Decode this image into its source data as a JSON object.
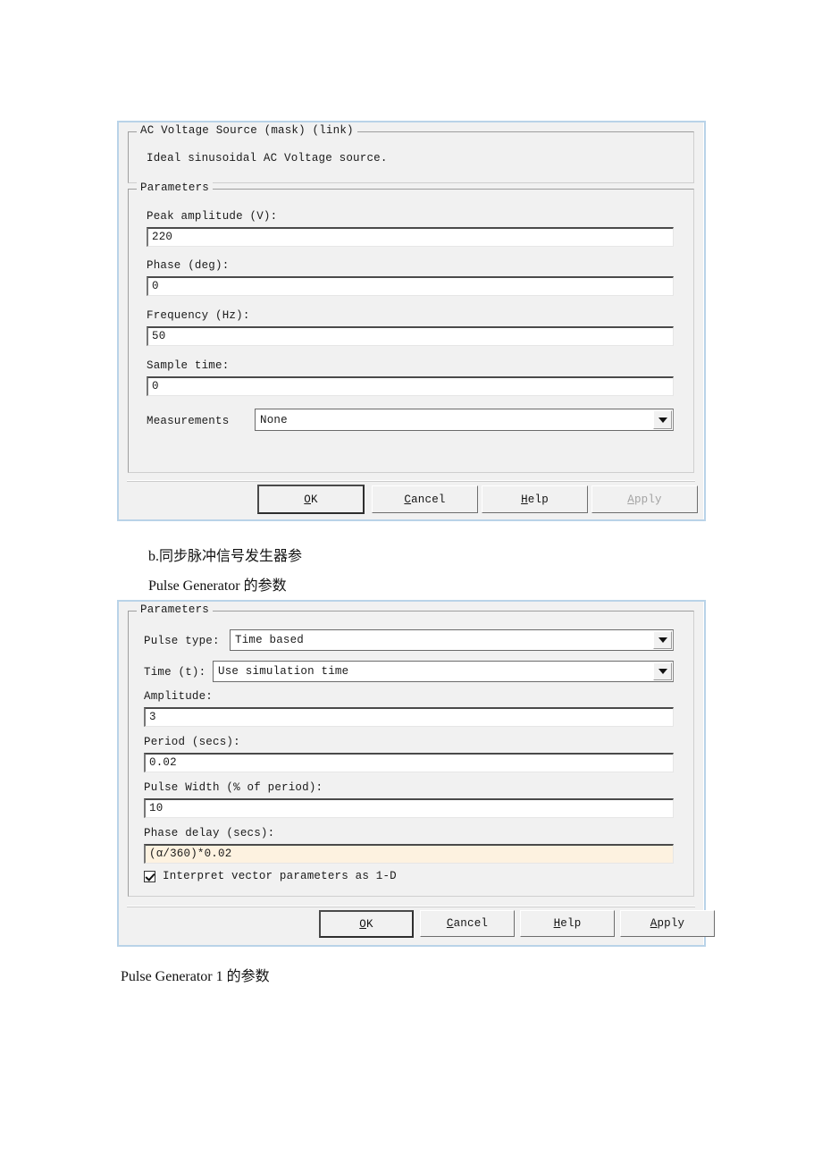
{
  "page": {
    "background": "#ffffff",
    "accent_border": "#b9d3e8",
    "highlight_field_color": "#fdf2e0"
  },
  "dialog_ac_voltage": {
    "description_group": {
      "title": "AC Voltage Source (mask) (link)",
      "text": "Ideal sinusoidal AC Voltage source."
    },
    "parameters_group": {
      "title": "Parameters"
    },
    "fields": [
      {
        "label": "Peak amplitude (V):",
        "value": "220",
        "type": "text"
      },
      {
        "label": "Phase (deg):",
        "value": "0",
        "type": "text"
      },
      {
        "label": "Frequency (Hz):",
        "value": "50",
        "type": "text"
      },
      {
        "label": "Sample time:",
        "value": "0",
        "type": "text"
      }
    ],
    "measurements": {
      "label": "Measurements",
      "value": "None",
      "type": "dropdown",
      "arrow_icon": "chevron-down-icon"
    },
    "buttons": [
      {
        "label": "OK",
        "mnemonic": "O",
        "rest": "K",
        "default": true,
        "disabled": false
      },
      {
        "label": "Cancel",
        "mnemonic": "C",
        "rest": "ancel",
        "default": false,
        "disabled": false
      },
      {
        "label": "Help",
        "mnemonic": "H",
        "rest": "elp",
        "default": false,
        "disabled": false
      },
      {
        "label": "Apply",
        "mnemonic": "A",
        "rest": "pply",
        "default": false,
        "disabled": true
      }
    ]
  },
  "caption_between": {
    "line1": "b.同步脉冲信号发生器参",
    "line2": "Pulse Generator  的参数"
  },
  "dialog_pulse_generator": {
    "parameters_group": {
      "title": "Parameters"
    },
    "inline_fields": [
      {
        "label": "Pulse type:",
        "value": "Time based",
        "type": "dropdown",
        "arrow_icon": "chevron-down-icon"
      },
      {
        "label": "Time (t):",
        "value": "Use simulation time",
        "type": "dropdown",
        "arrow_icon": "chevron-down-icon"
      }
    ],
    "stacked_fields": [
      {
        "label": "Amplitude:",
        "value": "3",
        "type": "text",
        "highlight": false
      },
      {
        "label": "Period (secs):",
        "value": "0.02",
        "type": "text",
        "highlight": false
      },
      {
        "label": "Pulse Width (% of period):",
        "value": "10",
        "type": "text",
        "highlight": false
      },
      {
        "label": "Phase delay (secs):",
        "value": "(α/360)*0.02",
        "type": "text",
        "highlight": true
      }
    ],
    "checkbox": {
      "label": "Interpret vector parameters as 1-D",
      "checked": true
    },
    "buttons": [
      {
        "label": "OK",
        "mnemonic": "O",
        "rest": "K",
        "default": true,
        "disabled": false
      },
      {
        "label": "Cancel",
        "mnemonic": "C",
        "rest": "ancel",
        "default": false,
        "disabled": false
      },
      {
        "label": "Help",
        "mnemonic": "H",
        "rest": "elp",
        "default": false,
        "disabled": false
      },
      {
        "label": "Apply",
        "mnemonic": "A",
        "rest": "pply",
        "default": false,
        "disabled": false
      }
    ]
  },
  "caption_bottom": {
    "line1": "Pulse Generator 1  的参数"
  }
}
